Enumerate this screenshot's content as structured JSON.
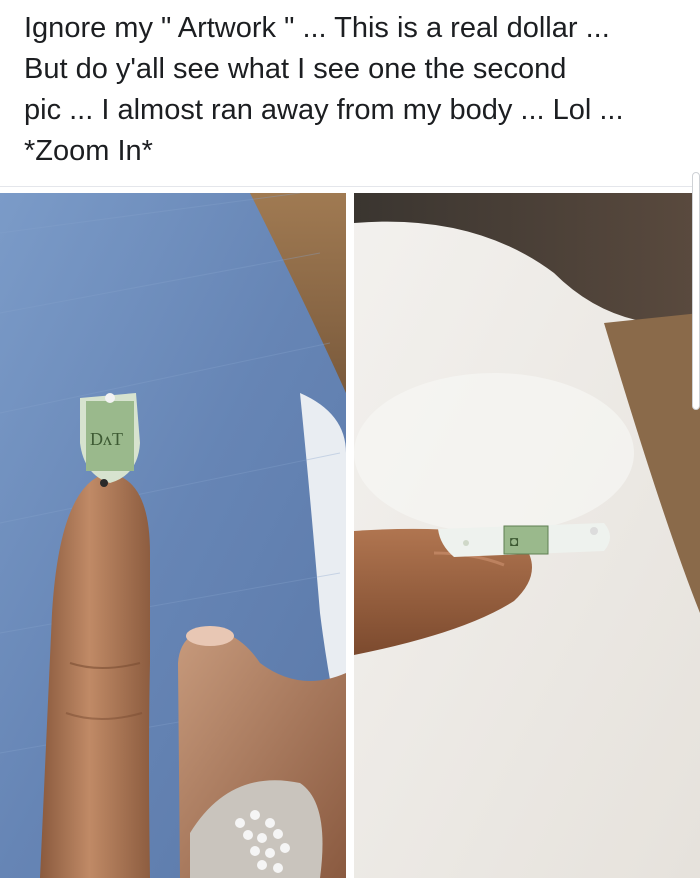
{
  "post": {
    "caption_lines": [
      "Ignore my \" Artwork \" ... This is a real dollar ...",
      "But do y'all see what I see one the second",
      "pic ... I almost ran away from my body ... Lol ...",
      "*Zoom In*"
    ]
  },
  "photos": [
    {
      "name": "photo-nail-top-view"
    },
    {
      "name": "photo-nail-side-view"
    }
  ],
  "colors": {
    "text": "#1c1e21",
    "background": "#ffffff",
    "denim": "#6f8fbd",
    "skin": "#b07a58",
    "bill_green": "#9ab98c",
    "rug": "#ece8e3"
  }
}
